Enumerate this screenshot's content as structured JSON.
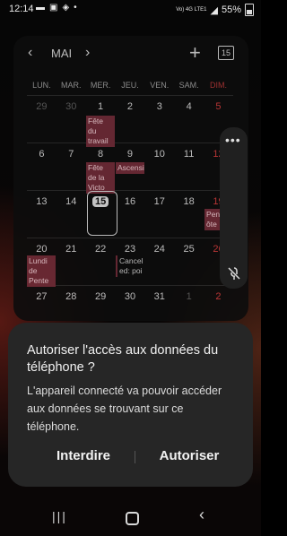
{
  "status_bar": {
    "time": "12:14",
    "icons": [
      "chat-icon",
      "image-icon",
      "shield-icon",
      "dot-icon"
    ],
    "network": "Vo) 4G LTE1",
    "battery": "55%"
  },
  "calendar": {
    "month": "MAI",
    "today_icon_text": "15",
    "weekdays": [
      "LUN.",
      "MAR.",
      "MER.",
      "JEU.",
      "VEN.",
      "SAM.",
      "DIM."
    ],
    "weeks": [
      [
        "29",
        "30",
        "1",
        "2",
        "3",
        "4",
        "5"
      ],
      [
        "6",
        "7",
        "8",
        "9",
        "10",
        "11",
        "12"
      ],
      [
        "13",
        "14",
        "15",
        "16",
        "17",
        "18",
        "19"
      ],
      [
        "20",
        "21",
        "22",
        "23",
        "24",
        "25",
        "26"
      ],
      [
        "27",
        "28",
        "29",
        "30",
        "31",
        "1",
        "2"
      ]
    ],
    "events": {
      "fete_travail": "Fête du travail",
      "fete_victoire": "Fête de la Victo",
      "ascension": "Ascension",
      "pentecote_right": "Pent ôte",
      "lundi_pentecote": "Lundi de Pente",
      "cancel": "Cancel ed: poi"
    }
  },
  "dialog": {
    "title": "Autoriser l'accès aux données du téléphone ?",
    "body": "L'appareil connecté va pouvoir accéder aux données se trouvant sur ce téléphone.",
    "deny_label": "Interdire",
    "allow_label": "Autoriser"
  },
  "colors": {
    "event_bg": "#6f2b37",
    "sunday": "#cc3b3b",
    "dialog_bg": "#262626"
  }
}
